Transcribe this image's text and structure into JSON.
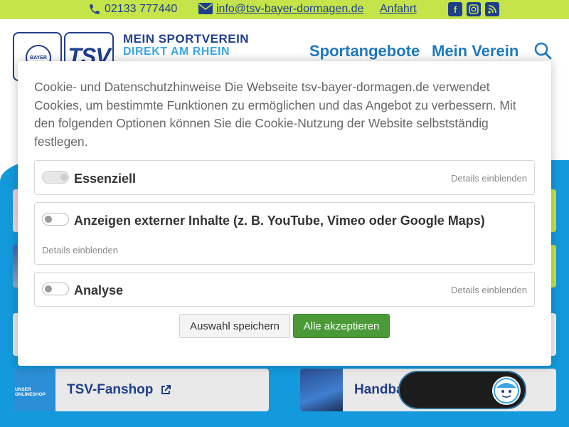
{
  "topbar": {
    "phone": "02133 777440",
    "email": "info@tsv-bayer-dormagen.de",
    "anfahrt": "Anfahrt",
    "icons": [
      "facebook-icon",
      "instagram-icon",
      "rss-icon"
    ]
  },
  "header": {
    "logo_bayer_text": "BAYER",
    "logo_tsv_text": "TSV",
    "slogan_line1": "MEIN SPORTVEREIN",
    "slogan_line2": "DIREKT AM RHEIN",
    "nav": [
      "Sportangebote",
      "Mein Verein"
    ]
  },
  "tiles": {
    "fanshop_label": "TSV-Fanshop",
    "fanshop_thumb_text": "UNSER ONLINESHOP",
    "handball_label": "Handbal"
  },
  "cookie": {
    "intro": "Cookie- und Datenschutzhinweise Die Webseite tsv-bayer-dormagen.de verwendet Cookies, um bestimmte Funktionen zu ermöglichen und das Angebot zu verbessern. Mit den folgenden Optionen können Sie die Cookie-Nutzung der Website selbstständig festlegen.",
    "options": [
      {
        "name": "Essenziell",
        "details": "Details einblenden",
        "enabled": true
      },
      {
        "name": "Anzeigen externer Inhalte (z. B. YouTube, Vimeo oder Google Maps)",
        "details": "Details einblenden",
        "enabled": false
      },
      {
        "name": "Analyse",
        "details": "Details einblenden",
        "enabled": false
      }
    ],
    "save_label": "Auswahl speichern",
    "accept_label": "Alle akzeptieren"
  },
  "colors": {
    "topbar": "#c5e44a",
    "brand_blue": "#1f3e8c",
    "background_blue": "#1499dc",
    "accept_green": "#4a9a38"
  }
}
